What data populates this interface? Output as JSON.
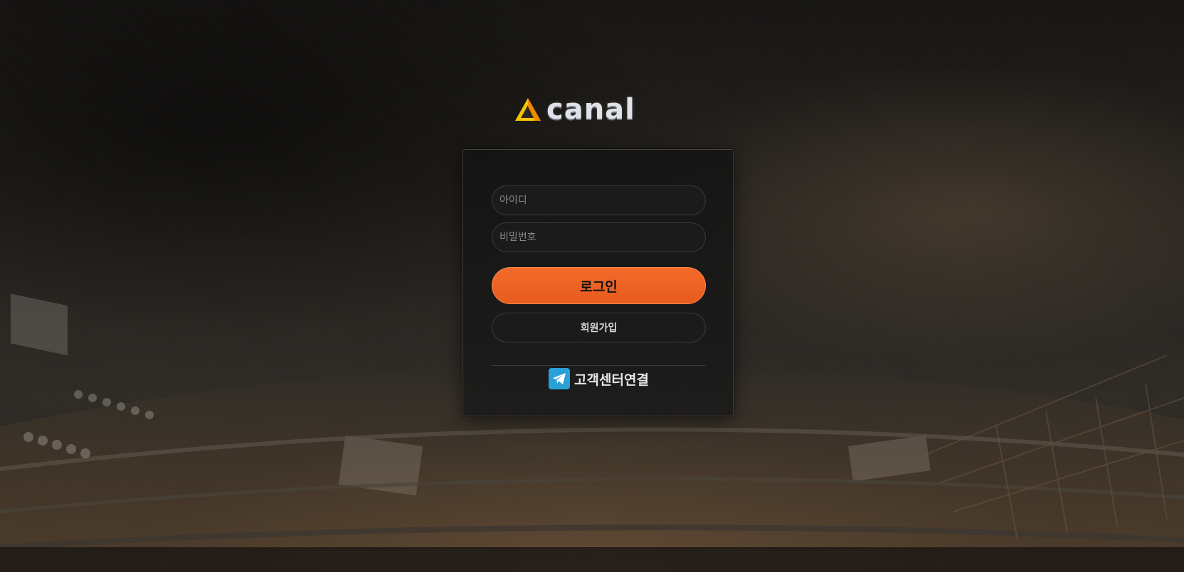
{
  "brand": {
    "logo_text": "CANAL",
    "accent": "#f2641f",
    "logo_colors": [
      "#f7c600",
      "#f08a00"
    ]
  },
  "login_form": {
    "id_placeholder": "아이디",
    "password_placeholder": "비밀번호",
    "login_label": "로그인",
    "signup_label": "회원가입",
    "support_label": "고객센터연결",
    "support_icon": "telegram-icon"
  }
}
